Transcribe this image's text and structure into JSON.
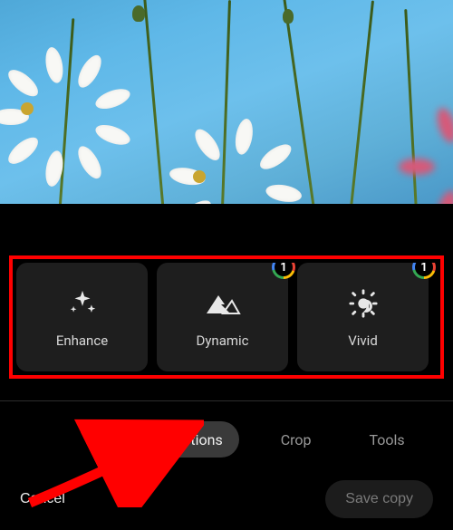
{
  "photo": {
    "alt": "White daisies against blue sky"
  },
  "suggestions": {
    "items": [
      {
        "label": "Enhance",
        "icon": "sparkle",
        "premium": false
      },
      {
        "label": "Dynamic",
        "icon": "mountain",
        "premium": true
      },
      {
        "label": "Vivid",
        "icon": "sun-partial",
        "premium": true
      },
      {
        "label": "",
        "icon": "",
        "premium": true
      }
    ]
  },
  "tabs": {
    "suggestions": "Suggestions",
    "crop": "Crop",
    "tools": "Tools"
  },
  "actions": {
    "cancel": "Cancel",
    "save": "Save copy"
  },
  "badge": {
    "one": "1"
  }
}
